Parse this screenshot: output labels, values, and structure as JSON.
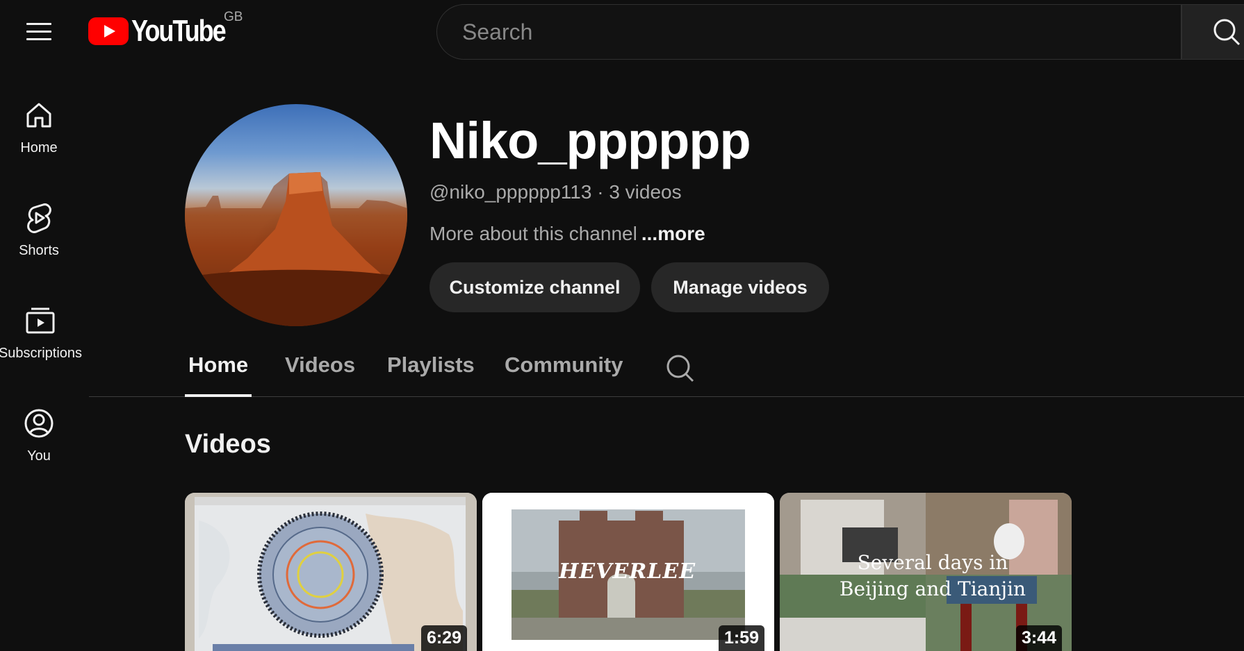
{
  "header": {
    "menu_label": "Menu",
    "logo_text": "YouTube",
    "country_code": "GB",
    "search_placeholder": "Search"
  },
  "sidebar": {
    "items": [
      {
        "label": "Home",
        "icon": "home-icon"
      },
      {
        "label": "Shorts",
        "icon": "shorts-icon"
      },
      {
        "label": "Subscriptions",
        "icon": "subscriptions-icon"
      },
      {
        "label": "You",
        "icon": "user-circle-icon"
      }
    ]
  },
  "channel": {
    "name": "Niko_pppppp",
    "meta": "@niko_pppppp113 · 3 videos",
    "about": "More about this channel",
    "more_link": "...more",
    "customize_label": "Customize channel",
    "manage_label": "Manage videos"
  },
  "tabs": [
    {
      "label": "Home",
      "active": true
    },
    {
      "label": "Videos",
      "active": false
    },
    {
      "label": "Playlists",
      "active": false
    },
    {
      "label": "Community",
      "active": false
    }
  ],
  "videos_section": {
    "title": "Videos",
    "items": [
      {
        "duration": "6:29",
        "overlay": ""
      },
      {
        "duration": "1:59",
        "overlay": "HEVERLEE"
      },
      {
        "duration": "3:44",
        "overlay": "Several days in Beijing and Tianjin"
      }
    ]
  },
  "colors": {
    "background": "#0f0f0f",
    "brand_red": "#ff0000",
    "pill": "#272727",
    "secondary_text": "#aaaaaa"
  }
}
